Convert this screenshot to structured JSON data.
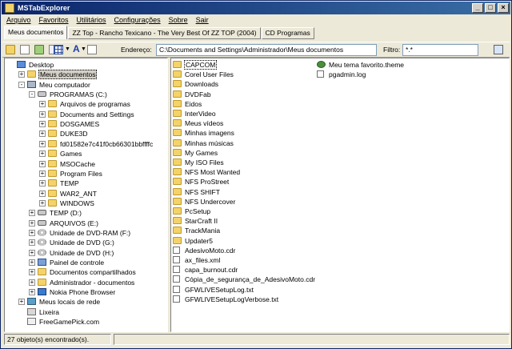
{
  "window": {
    "title": "MSTabExplorer"
  },
  "menu": [
    "Arquivo",
    "Favoritos",
    "Utilitários",
    "Configurações",
    "Sobre",
    "Sair"
  ],
  "tabs": [
    {
      "label": "Meus documentos",
      "active": true
    },
    {
      "label": "ZZ Top - Rancho Texicano - The Very Best Of ZZ TOP (2004)",
      "active": false
    },
    {
      "label": "CD Programas",
      "active": false
    }
  ],
  "toolbar": {
    "address_label": "Endereço:",
    "address_value": "C:\\Documents and Settings\\Administrador\\Meus documentos",
    "filter_label": "Filtro:",
    "filter_value": "*.*"
  },
  "tree": [
    {
      "label": "Desktop",
      "icon": "desktop-icon",
      "expander": ""
    },
    {
      "label": "Meus documentos",
      "icon": "folder-icon",
      "expander": "+",
      "selected": true
    },
    {
      "label": "Meu computador",
      "icon": "computer-icon",
      "expander": "-"
    },
    {
      "label": "PROGRAMAS (C:)",
      "icon": "drive-icon",
      "expander": "-"
    },
    {
      "label": "Arquivos de programas",
      "icon": "folder-icon",
      "expander": "+"
    },
    {
      "label": "Documents and Settings",
      "icon": "folder-icon",
      "expander": "+"
    },
    {
      "label": "DOSGAMES",
      "icon": "folder-icon",
      "expander": "+"
    },
    {
      "label": "DUKE3D",
      "icon": "folder-icon",
      "expander": "+"
    },
    {
      "label": "fd01582e7c41f0cb66301bbffffc",
      "icon": "folder-icon",
      "expander": "+"
    },
    {
      "label": "Games",
      "icon": "folder-icon",
      "expander": "+"
    },
    {
      "label": "MSOCache",
      "icon": "folder-icon",
      "expander": "+"
    },
    {
      "label": "Program Files",
      "icon": "folder-icon",
      "expander": "+"
    },
    {
      "label": "TEMP",
      "icon": "folder-icon",
      "expander": "+"
    },
    {
      "label": "WAR2_ANT",
      "icon": "folder-icon",
      "expander": "+"
    },
    {
      "label": "WINDOWS",
      "icon": "folder-icon",
      "expander": "+"
    },
    {
      "label": "TEMP (D:)",
      "icon": "drive-icon",
      "expander": "+"
    },
    {
      "label": "ARQUIVOS (E:)",
      "icon": "drive-icon",
      "expander": "+"
    },
    {
      "label": "Unidade de DVD-RAM (F:)",
      "icon": "dvd-icon",
      "expander": "+"
    },
    {
      "label": "Unidade de DVD (G:)",
      "icon": "dvd-icon",
      "expander": "+"
    },
    {
      "label": "Unidade de DVD (H:)",
      "icon": "dvd-icon",
      "expander": "+"
    },
    {
      "label": "Painel de controle",
      "icon": "control-panel-icon",
      "expander": "+"
    },
    {
      "label": "Documentos compartilhados",
      "icon": "folder-icon",
      "expander": "+"
    },
    {
      "label": "Administrador - documentos",
      "icon": "folder-icon",
      "expander": "+"
    },
    {
      "label": "Nokia Phone Browser",
      "icon": "phone-icon",
      "expander": "+"
    },
    {
      "label": "Meus locais de rede",
      "icon": "network-icon",
      "expander": "+"
    },
    {
      "label": "Lixeira",
      "icon": "recycle-bin-icon",
      "expander": ""
    },
    {
      "label": "FreeGamePick.com",
      "icon": "web-icon",
      "expander": ""
    }
  ],
  "files_col1": [
    {
      "label": "CAPCOM",
      "icon": "folder-icon"
    },
    {
      "label": "Corel User Files",
      "icon": "folder-icon"
    },
    {
      "label": "Downloads",
      "icon": "folder-icon"
    },
    {
      "label": "DVDFab",
      "icon": "folder-icon"
    },
    {
      "label": "Eidos",
      "icon": "folder-icon"
    },
    {
      "label": "InterVideo",
      "icon": "folder-icon"
    },
    {
      "label": "Meus vídeos",
      "icon": "folder-icon"
    },
    {
      "label": "Minhas imagens",
      "icon": "folder-icon"
    },
    {
      "label": "Minhas músicas",
      "icon": "folder-icon"
    },
    {
      "label": "My Games",
      "icon": "folder-icon"
    },
    {
      "label": "My ISO Files",
      "icon": "folder-icon"
    },
    {
      "label": "NFS Most Wanted",
      "icon": "folder-icon"
    },
    {
      "label": "NFS ProStreet",
      "icon": "folder-icon"
    },
    {
      "label": "NFS SHIFT",
      "icon": "folder-icon"
    },
    {
      "label": "NFS Undercover",
      "icon": "folder-icon"
    },
    {
      "label": "PcSetup",
      "icon": "folder-icon"
    },
    {
      "label": "StarCraft II",
      "icon": "folder-icon"
    },
    {
      "label": "TrackMania",
      "icon": "folder-icon"
    },
    {
      "label": "Updater5",
      "icon": "folder-icon"
    },
    {
      "label": "AdesivoMoto.cdr",
      "icon": "file-icon"
    },
    {
      "label": "ax_files.xml",
      "icon": "file-icon"
    },
    {
      "label": "capa_burnout.cdr",
      "icon": "file-icon"
    },
    {
      "label": "Cópia_de_segurança_de_AdesivoMoto.cdr",
      "icon": "file-icon"
    },
    {
      "label": "GFWLIVESetupLog.txt",
      "icon": "file-icon"
    },
    {
      "label": "GFWLIVESetupLogVerbose.txt",
      "icon": "file-icon"
    }
  ],
  "files_col2": [
    {
      "label": "Meu tema favorito.theme",
      "icon": "theme-icon"
    },
    {
      "label": "pgadmin.log",
      "icon": "file-icon"
    }
  ],
  "status": {
    "text": "27 objeto(s) encontrado(s)."
  }
}
